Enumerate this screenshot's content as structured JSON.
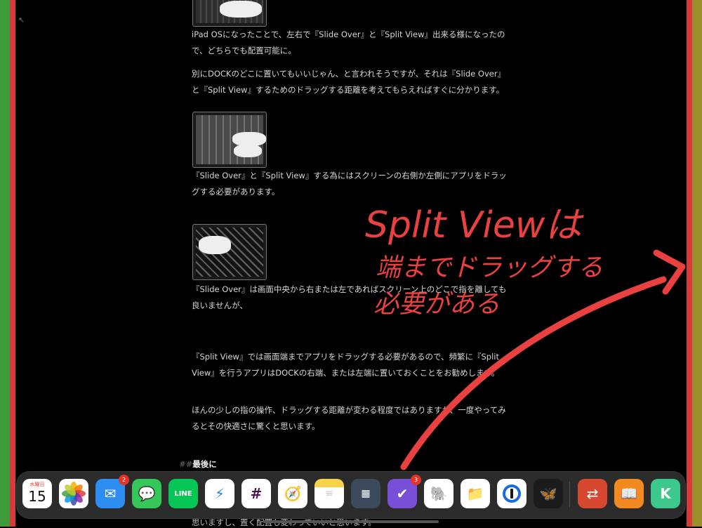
{
  "edges": {
    "left_colors": [
      "#3f9a3a",
      "#d63a3a"
    ],
    "right_colors": [
      "#d63a3a",
      "#9a8f2a"
    ]
  },
  "article": {
    "paragraphs": [
      "iPad OSになったことで、左右で『Slide Over』と『Split View』出来る様になったので、どちらでも配置可能に。",
      "別にDOCKのどこに置いてもいいじゃん、と言われそうですが、それは『Slide Over』と『Split View』するためのドラッグする距離を考えてもらえればすぐに分かります。",
      "『Slide Over』と『Split View』する為にはスクリーンの右側か左側にアプリをドラッグする必要があります。",
      "『Slide Over』は画面中央から右または左であればスクリーン上のどこで指を離しても良いませんが、",
      "『Split View』では画面端までアプリをドラッグする必要があるので、頻繁に『Split View』を行うアプリはDOCKの右端、または左端に置いておくことをお勧めします。",
      "ほんの少しの指の操作、ドラッグする距離が変わる程度ではありますが、一度やってみるとその快適さに驚くと思います。"
    ],
    "heading_hash": "##",
    "heading": "最後に",
    "bottom_partial": "思いますし、置く配置も変わっていいと思います。"
  },
  "annotation": {
    "line1": "Split Viewは",
    "line2": "端までドラッグする",
    "line3": "必要がある",
    "color": "#e8413f"
  },
  "dock": {
    "apps": [
      {
        "name": "calendar",
        "icon": "calendar-icon",
        "day": "水曜日",
        "date": "15"
      },
      {
        "name": "photos",
        "icon": "photos-icon"
      },
      {
        "name": "mail",
        "icon": "mail-icon",
        "badge": "2"
      },
      {
        "name": "messages",
        "icon": "messages-icon"
      },
      {
        "name": "line",
        "icon": "line-icon",
        "label": "LINE"
      },
      {
        "name": "messenger",
        "icon": "messenger-icon"
      },
      {
        "name": "slack",
        "icon": "slack-icon"
      },
      {
        "name": "safari",
        "icon": "safari-icon"
      },
      {
        "name": "notes",
        "icon": "notes-icon"
      },
      {
        "name": "calculator-app",
        "icon": "calculator-icon"
      },
      {
        "name": "omnifocus",
        "icon": "checkmark-icon",
        "badge": "3"
      },
      {
        "name": "evernote",
        "icon": "evernote-icon"
      },
      {
        "name": "files",
        "icon": "folder-icon"
      },
      {
        "name": "1password",
        "icon": "1password-icon"
      },
      {
        "name": "tes",
        "icon": "butterfly-icon"
      },
      {
        "name": "remote-desktop",
        "icon": "remote-desktop-icon"
      },
      {
        "name": "books",
        "icon": "books-icon"
      },
      {
        "name": "app-green",
        "icon": "app-icon"
      }
    ]
  }
}
